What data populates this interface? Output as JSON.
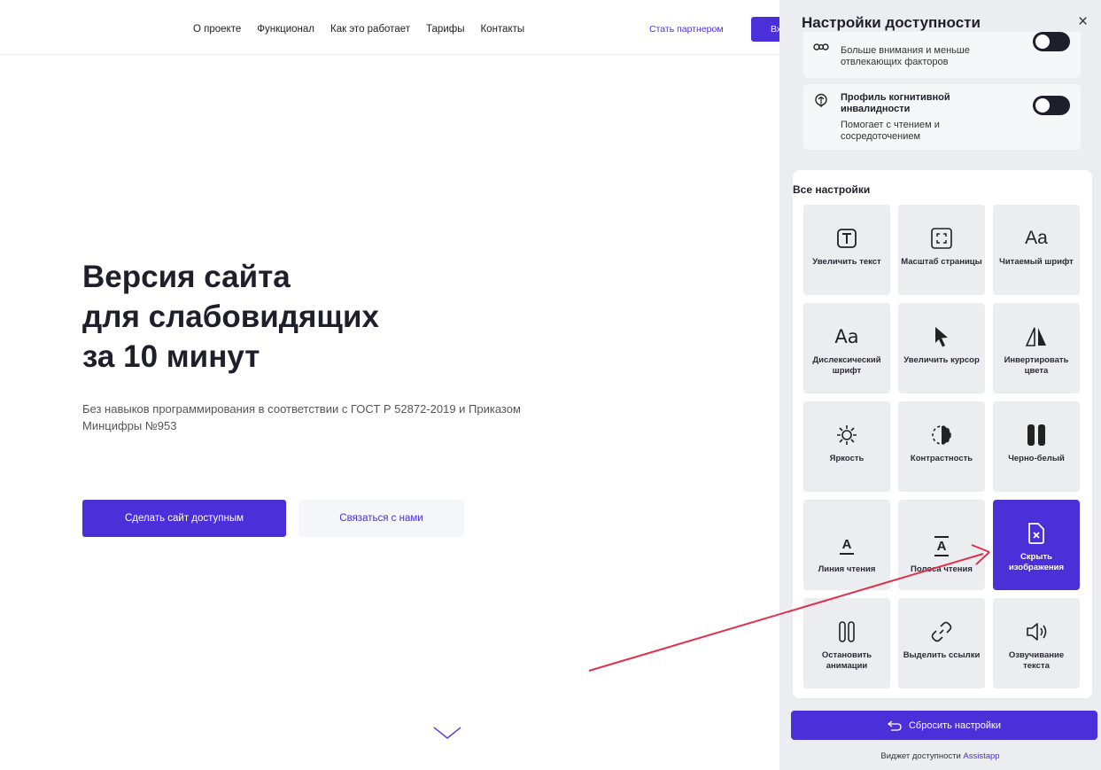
{
  "nav": {
    "links": [
      "О проекте",
      "Функционал",
      "Как это работает",
      "Тарифы",
      "Контакты"
    ],
    "partner": "Стать партнером",
    "login": "Вх"
  },
  "hero": {
    "title_lines": [
      "Версия сайта",
      "для слабовидящих",
      "за 10 минут"
    ],
    "subtitle": "Без навыков программирования в соответствии с ГОСТ Р 52872-2019 и Приказом Минцифры №953",
    "cta_primary": "Сделать сайт доступным",
    "cta_secondary": "Связаться с нами"
  },
  "panel": {
    "title": "Настройки доступности",
    "close": "×",
    "profiles": [
      {
        "name": "",
        "desc": "Больше внимания и меньше отвлекающих факторов",
        "icon": "glasses-icon"
      },
      {
        "name": "Профиль когнитивной инвалидности",
        "desc": "Помогает с чтением и сосредоточением",
        "icon": "brain-icon"
      }
    ],
    "all_settings": "Все настройки",
    "tiles": [
      {
        "label": "Увеличить текст",
        "icon": "text-size-icon"
      },
      {
        "label": "Масштаб страницы",
        "icon": "expand-icon"
      },
      {
        "label": "Читаемый шрифт",
        "icon": "font-icon",
        "glyph": "Aa"
      },
      {
        "label": "Дислексический шрифт",
        "icon": "dyslexic-font-icon",
        "glyph": "Aa"
      },
      {
        "label": "Увеличить курсор",
        "icon": "cursor-icon"
      },
      {
        "label": "Инвертировать цвета",
        "icon": "invert-icon"
      },
      {
        "label": "Яркость",
        "icon": "brightness-icon"
      },
      {
        "label": "Контрастность",
        "icon": "contrast-icon"
      },
      {
        "label": "Черно-белый",
        "icon": "pause-icon"
      },
      {
        "label": "Линия чтения",
        "icon": "reading-line-icon",
        "glyph": "A"
      },
      {
        "label": "Полоса чтения",
        "icon": "reading-mask-icon",
        "glyph": "A"
      },
      {
        "label": "Скрыть изображения",
        "icon": "hide-images-icon",
        "active": true
      },
      {
        "label": "Остановить анимации",
        "icon": "stop-animation-icon"
      },
      {
        "label": "Выделить ссылки",
        "icon": "link-icon"
      },
      {
        "label": "Озвучивание текста",
        "icon": "speaker-icon"
      }
    ],
    "reset": "Сбросить настройки",
    "footer_text": "Виджет доступности",
    "footer_link": "Assistapp"
  },
  "colors": {
    "accent": "#4b2fd9",
    "annotation": "#e0314b"
  }
}
